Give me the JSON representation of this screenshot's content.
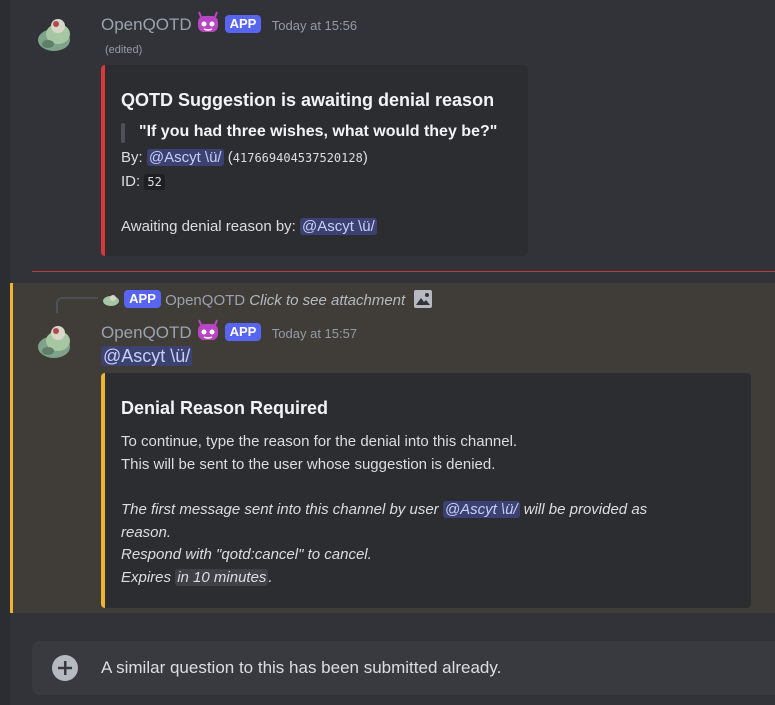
{
  "message1": {
    "username": "OpenQOTD",
    "app_tag": "APP",
    "timestamp": "Today at 15:56",
    "edited": "(edited)",
    "embed": {
      "title": "QOTD Suggestion is awaiting denial reason",
      "quote": "\"If you had three wishes, what would they be?\"",
      "by_label": "By:",
      "by_mention": "@Ascyt \\ü/",
      "user_id": "417669404537520128",
      "id_label": "ID:",
      "id_value": "52",
      "awaiting_label": "Awaiting denial reason by:",
      "awaiting_mention": "@Ascyt \\ü/",
      "bar_color": "#da373c"
    }
  },
  "reply": {
    "app_tag": "APP",
    "username": "OpenQOTD",
    "text": "Click to see attachment"
  },
  "message2": {
    "username": "OpenQOTD",
    "app_tag": "APP",
    "timestamp": "Today at 15:57",
    "mention": "@Ascyt \\ü/",
    "embed": {
      "title": "Denial Reason Required",
      "line1": "To continue, type the reason for the denial into this channel.",
      "line2": "This will be sent to the user whose suggestion is denied.",
      "italic_prefix": "The first message sent into this channel by user",
      "italic_mention": "@Ascyt \\ü/",
      "italic_suffix": "will be provided as",
      "italic_line2": "reason.",
      "italic_line3": "Respond with \"qotd:cancel\" to cancel.",
      "expires_prefix": "Expires",
      "expires_value": "in 10 minutes",
      "expires_suffix": ".",
      "bar_color": "#f0b232"
    }
  },
  "composer": {
    "text": "A similar question to this has been submitted already."
  },
  "colors": {
    "accent": "#5865f2",
    "mention_bg": "#3c4270",
    "highlight": "#403d38"
  }
}
